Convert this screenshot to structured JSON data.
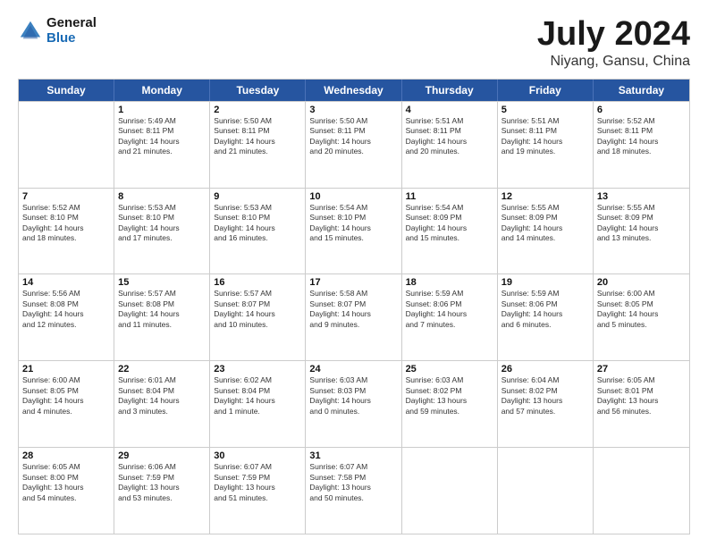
{
  "header": {
    "logo_general": "General",
    "logo_blue": "Blue",
    "title": "July 2024",
    "location": "Niyang, Gansu, China"
  },
  "days": [
    "Sunday",
    "Monday",
    "Tuesday",
    "Wednesday",
    "Thursday",
    "Friday",
    "Saturday"
  ],
  "rows": [
    [
      {
        "date": "",
        "info": ""
      },
      {
        "date": "1",
        "info": "Sunrise: 5:49 AM\nSunset: 8:11 PM\nDaylight: 14 hours\nand 21 minutes."
      },
      {
        "date": "2",
        "info": "Sunrise: 5:50 AM\nSunset: 8:11 PM\nDaylight: 14 hours\nand 21 minutes."
      },
      {
        "date": "3",
        "info": "Sunrise: 5:50 AM\nSunset: 8:11 PM\nDaylight: 14 hours\nand 20 minutes."
      },
      {
        "date": "4",
        "info": "Sunrise: 5:51 AM\nSunset: 8:11 PM\nDaylight: 14 hours\nand 20 minutes."
      },
      {
        "date": "5",
        "info": "Sunrise: 5:51 AM\nSunset: 8:11 PM\nDaylight: 14 hours\nand 19 minutes."
      },
      {
        "date": "6",
        "info": "Sunrise: 5:52 AM\nSunset: 8:11 PM\nDaylight: 14 hours\nand 18 minutes."
      }
    ],
    [
      {
        "date": "7",
        "info": "Sunrise: 5:52 AM\nSunset: 8:10 PM\nDaylight: 14 hours\nand 18 minutes."
      },
      {
        "date": "8",
        "info": "Sunrise: 5:53 AM\nSunset: 8:10 PM\nDaylight: 14 hours\nand 17 minutes."
      },
      {
        "date": "9",
        "info": "Sunrise: 5:53 AM\nSunset: 8:10 PM\nDaylight: 14 hours\nand 16 minutes."
      },
      {
        "date": "10",
        "info": "Sunrise: 5:54 AM\nSunset: 8:10 PM\nDaylight: 14 hours\nand 15 minutes."
      },
      {
        "date": "11",
        "info": "Sunrise: 5:54 AM\nSunset: 8:09 PM\nDaylight: 14 hours\nand 15 minutes."
      },
      {
        "date": "12",
        "info": "Sunrise: 5:55 AM\nSunset: 8:09 PM\nDaylight: 14 hours\nand 14 minutes."
      },
      {
        "date": "13",
        "info": "Sunrise: 5:55 AM\nSunset: 8:09 PM\nDaylight: 14 hours\nand 13 minutes."
      }
    ],
    [
      {
        "date": "14",
        "info": "Sunrise: 5:56 AM\nSunset: 8:08 PM\nDaylight: 14 hours\nand 12 minutes."
      },
      {
        "date": "15",
        "info": "Sunrise: 5:57 AM\nSunset: 8:08 PM\nDaylight: 14 hours\nand 11 minutes."
      },
      {
        "date": "16",
        "info": "Sunrise: 5:57 AM\nSunset: 8:07 PM\nDaylight: 14 hours\nand 10 minutes."
      },
      {
        "date": "17",
        "info": "Sunrise: 5:58 AM\nSunset: 8:07 PM\nDaylight: 14 hours\nand 9 minutes."
      },
      {
        "date": "18",
        "info": "Sunrise: 5:59 AM\nSunset: 8:06 PM\nDaylight: 14 hours\nand 7 minutes."
      },
      {
        "date": "19",
        "info": "Sunrise: 5:59 AM\nSunset: 8:06 PM\nDaylight: 14 hours\nand 6 minutes."
      },
      {
        "date": "20",
        "info": "Sunrise: 6:00 AM\nSunset: 8:05 PM\nDaylight: 14 hours\nand 5 minutes."
      }
    ],
    [
      {
        "date": "21",
        "info": "Sunrise: 6:00 AM\nSunset: 8:05 PM\nDaylight: 14 hours\nand 4 minutes."
      },
      {
        "date": "22",
        "info": "Sunrise: 6:01 AM\nSunset: 8:04 PM\nDaylight: 14 hours\nand 3 minutes."
      },
      {
        "date": "23",
        "info": "Sunrise: 6:02 AM\nSunset: 8:04 PM\nDaylight: 14 hours\nand 1 minute."
      },
      {
        "date": "24",
        "info": "Sunrise: 6:03 AM\nSunset: 8:03 PM\nDaylight: 14 hours\nand 0 minutes."
      },
      {
        "date": "25",
        "info": "Sunrise: 6:03 AM\nSunset: 8:02 PM\nDaylight: 13 hours\nand 59 minutes."
      },
      {
        "date": "26",
        "info": "Sunrise: 6:04 AM\nSunset: 8:02 PM\nDaylight: 13 hours\nand 57 minutes."
      },
      {
        "date": "27",
        "info": "Sunrise: 6:05 AM\nSunset: 8:01 PM\nDaylight: 13 hours\nand 56 minutes."
      }
    ],
    [
      {
        "date": "28",
        "info": "Sunrise: 6:05 AM\nSunset: 8:00 PM\nDaylight: 13 hours\nand 54 minutes."
      },
      {
        "date": "29",
        "info": "Sunrise: 6:06 AM\nSunset: 7:59 PM\nDaylight: 13 hours\nand 53 minutes."
      },
      {
        "date": "30",
        "info": "Sunrise: 6:07 AM\nSunset: 7:59 PM\nDaylight: 13 hours\nand 51 minutes."
      },
      {
        "date": "31",
        "info": "Sunrise: 6:07 AM\nSunset: 7:58 PM\nDaylight: 13 hours\nand 50 minutes."
      },
      {
        "date": "",
        "info": ""
      },
      {
        "date": "",
        "info": ""
      },
      {
        "date": "",
        "info": ""
      }
    ]
  ]
}
